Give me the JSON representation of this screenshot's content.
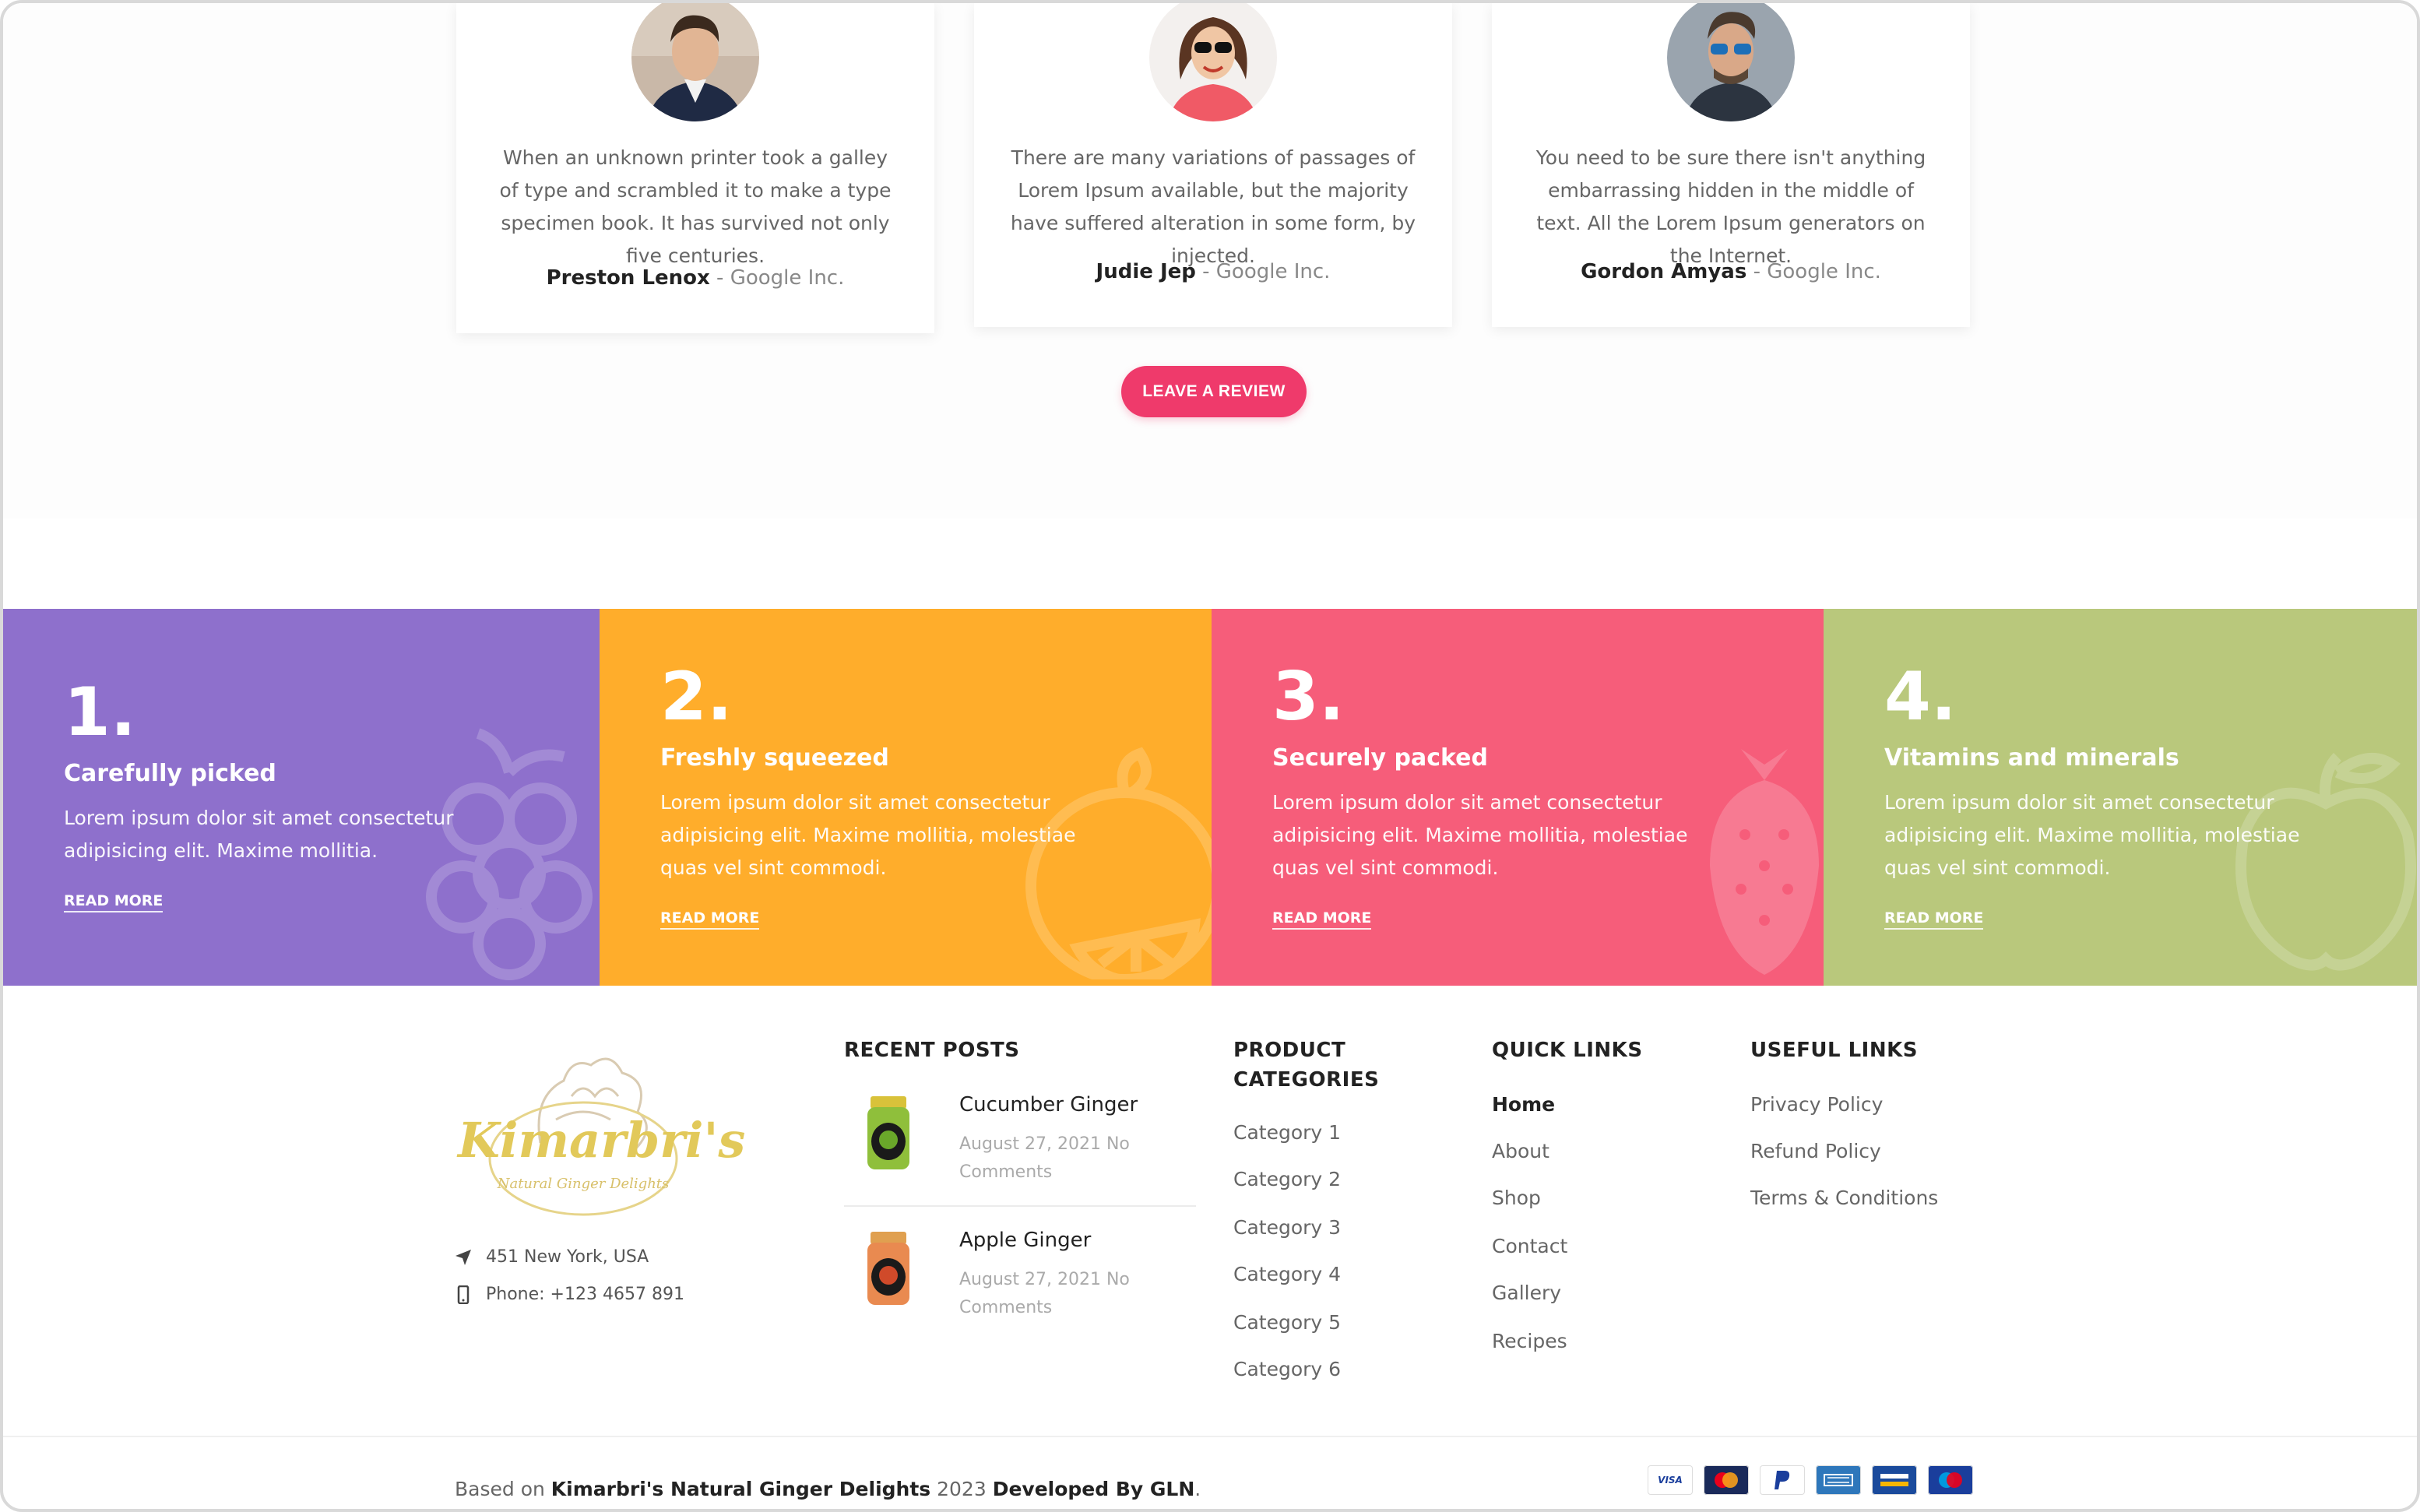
{
  "testimonials": [
    {
      "quote": "When an unknown printer took a galley of type and scrambled it to make a type specimen book. It has survived not only five centuries.",
      "name": "Preston Lenox",
      "company": " - Google Inc."
    },
    {
      "quote": "There are many variations of passages of Lorem Ipsum available, but the majority have suffered alteration in some form, by injected.",
      "name": "Judie Jep",
      "company": " - Google Inc."
    },
    {
      "quote": "You need to be sure there isn't anything embarrassing hidden in the middle of text. All the Lorem Ipsum generators on the Internet.",
      "name": "Gordon Amyas",
      "company": " - Google Inc."
    }
  ],
  "review_button": "LEAVE A REVIEW",
  "features": [
    {
      "number": "1.",
      "title": "Carefully picked",
      "text": "Lorem ipsum dolor sit amet consectetur adipisicing elit. Maxime mollitia.",
      "link": "READ MORE",
      "color": "#8e70cc",
      "icon": "grapes-icon"
    },
    {
      "number": "2.",
      "title": "Freshly squeezed",
      "text": "Lorem ipsum dolor sit amet consectetur adipisicing elit. Maxime mollitia, molestiae quas vel sint commodi.",
      "link": "READ MORE",
      "color": "#ffad2b",
      "icon": "orange-icon"
    },
    {
      "number": "3.",
      "title": "Securely packed",
      "text": "Lorem ipsum dolor sit amet consectetur adipisicing elit. Maxime mollitia, molestiae quas vel sint commodi.",
      "link": "READ MORE",
      "color": "#f65d7a",
      "icon": "strawberry-icon"
    },
    {
      "number": "4.",
      "title": "Vitamins and minerals",
      "text": "Lorem ipsum dolor sit amet consectetur adipisicing elit. Maxime mollitia, molestiae quas vel sint commodi.",
      "link": "READ MORE",
      "color": "#b9c87c",
      "icon": "apple-icon"
    }
  ],
  "footer": {
    "logo_text": "Kimarbri's",
    "logo_sub": "Natural Ginger Delights",
    "address": "451 New York, USA",
    "phone": "Phone: +123 4657 891",
    "recent_posts_title": "RECENT POSTS",
    "posts": [
      {
        "title": "Cucumber Ginger",
        "meta": "August 27, 2021  No Comments"
      },
      {
        "title": "Apple Ginger",
        "meta": "August 27, 2021  No Comments"
      }
    ],
    "product_categories_title": "PRODUCT CATEGORIES",
    "categories": [
      "Category 1",
      "Category 2",
      "Category 3",
      "Category 4",
      "Category 5",
      "Category 6"
    ],
    "quick_links_title": "QUICK LINKS",
    "quick_links": [
      "Home",
      "About",
      "Shop",
      "Contact",
      "Gallery",
      "Recipes"
    ],
    "useful_links_title": "USEFUL LINKS",
    "useful_links": [
      "Privacy Policy",
      "Refund Policy",
      "Terms & Conditions"
    ]
  },
  "copyright": {
    "prefix": "Based on ",
    "brand": "Kimarbri's Natural Ginger Delights",
    "year": " 2023 ",
    "developer": "Developed By GLN",
    "suffix": "."
  },
  "payment_cards": [
    "VISA",
    "MasterCard",
    "PayPal",
    "AmEx",
    "Electron",
    "Maestro"
  ]
}
